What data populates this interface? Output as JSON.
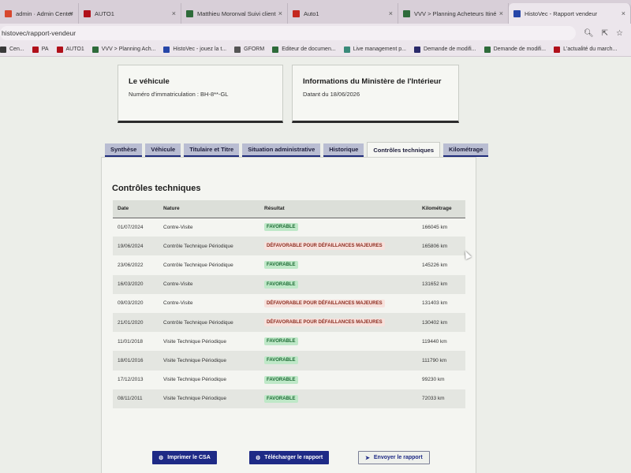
{
  "browser": {
    "tabs": [
      {
        "label": "admin · Admin Center",
        "color": "#d7472e"
      },
      {
        "label": "AUTO1",
        "color": "#b0101a"
      },
      {
        "label": "Matthieu Moronval Suivi client",
        "color": "#2e6b3a"
      },
      {
        "label": "Auto1",
        "color": "#c4281f"
      },
      {
        "label": "VVV > Planning Acheteurs Itiné",
        "color": "#2e6b3a"
      },
      {
        "label": "HistoVec - Rapport vendeur",
        "color": "#2646a8"
      }
    ],
    "url": "histovec/rapport-vendeur",
    "bookmarks": [
      {
        "label": "Cen...",
        "color": "#3a3a3a"
      },
      {
        "label": "PA",
        "color": "#b0101a"
      },
      {
        "label": "AUTO1",
        "color": "#b0101a"
      },
      {
        "label": "VVV > Planning Ach...",
        "color": "#2e6b3a"
      },
      {
        "label": "HistoVec - jouez la t...",
        "color": "#2646a8"
      },
      {
        "label": "GFORM",
        "color": "#555555"
      },
      {
        "label": "Editeur de documen...",
        "color": "#2e6b3a"
      },
      {
        "label": "Live management p...",
        "color": "#3a8a7a"
      },
      {
        "label": "Demande de modifi...",
        "color": "#2a2a6a"
      },
      {
        "label": "Demande de modifi...",
        "color": "#2e6b3a"
      },
      {
        "label": "L'actualité du march...",
        "color": "#b0101a"
      }
    ]
  },
  "vehicle_card": {
    "title": "Le véhicule",
    "plate_line": "Numéro d'immatriculation : BH-8**-GL"
  },
  "ministry_card": {
    "title": "Informations du Ministère de l'Intérieur",
    "date_line": "Datant du 18/06/2026"
  },
  "tabs": [
    {
      "label": "Synthèse",
      "active": false
    },
    {
      "label": "Véhicule",
      "active": false
    },
    {
      "label": "Titulaire et Titre",
      "active": false
    },
    {
      "label": "Situation administrative",
      "active": false
    },
    {
      "label": "Historique",
      "active": false
    },
    {
      "label": "Contrôles techniques",
      "active": true
    },
    {
      "label": "Kilométrage",
      "active": false
    }
  ],
  "section_title": "Contrôles techniques",
  "table": {
    "headers": [
      "Date",
      "Nature",
      "Résultat",
      "Kilométrage"
    ],
    "rows": [
      {
        "date": "01/07/2024",
        "nature": "Contre-Visite",
        "result": "FAVORABLE",
        "ok": true,
        "km": "166045 km"
      },
      {
        "date": "19/06/2024",
        "nature": "Contrôle Technique Périodique",
        "result": "DÉFAVORABLE POUR DÉFAILLANCES MAJEURES",
        "ok": false,
        "km": "165806 km"
      },
      {
        "date": "23/06/2022",
        "nature": "Contrôle Technique Périodique",
        "result": "FAVORABLE",
        "ok": true,
        "km": "145226 km"
      },
      {
        "date": "16/03/2020",
        "nature": "Contre-Visite",
        "result": "FAVORABLE",
        "ok": true,
        "km": "131652 km"
      },
      {
        "date": "09/03/2020",
        "nature": "Contre-Visite",
        "result": "DÉFAVORABLE POUR DÉFAILLANCES MAJEURES",
        "ok": false,
        "km": "131403 km"
      },
      {
        "date": "21/01/2020",
        "nature": "Contrôle Technique Périodique",
        "result": "DÉFAVORABLE POUR DÉFAILLANCES MAJEURES",
        "ok": false,
        "km": "130402 km"
      },
      {
        "date": "11/01/2018",
        "nature": "Visite Technique Périodique",
        "result": "FAVORABLE",
        "ok": true,
        "km": "119440 km"
      },
      {
        "date": "18/01/2016",
        "nature": "Visite Technique Périodique",
        "result": "FAVORABLE",
        "ok": true,
        "km": "111790 km"
      },
      {
        "date": "17/12/2013",
        "nature": "Visite Technique Périodique",
        "result": "FAVORABLE",
        "ok": true,
        "km": "99230 km"
      },
      {
        "date": "08/11/2011",
        "nature": "Visite Technique Périodique",
        "result": "FAVORABLE",
        "ok": true,
        "km": "72033 km"
      }
    ]
  },
  "buttons": {
    "print": "Imprimer le CSA",
    "download": "Télécharger le rapport",
    "send": "Envoyer le rapport"
  },
  "colors": {
    "primary": "#1e2a86",
    "favorable_bg": "#bfe8c8",
    "unfavorable_bg": "#f7e1dc"
  }
}
